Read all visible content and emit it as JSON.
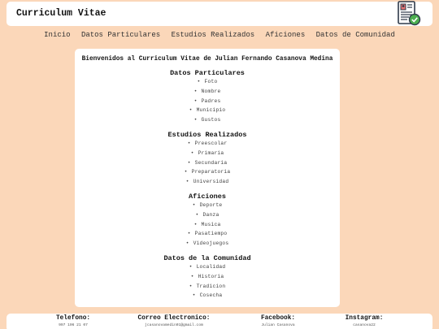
{
  "header": {
    "title": "Curriculum Vitae",
    "logo_icon": "cv-document-check-icon"
  },
  "nav": {
    "items": [
      "Inicio",
      "Datos Particulares",
      "Estudios Realizados",
      "Aficiones",
      "Datos de Comunidad"
    ]
  },
  "main": {
    "welcome": "Bienvenidos al Curriculum Vitae de Julian Fernando Casanova Medina",
    "sections": [
      {
        "title": "Datos Particulares",
        "items": [
          "Foto",
          "Nombre",
          "Padres",
          "Municipio",
          "Gustos"
        ]
      },
      {
        "title": "Estudios Realizados",
        "items": [
          "Preescolar",
          "Primaria",
          "Secundaria",
          "Preparatoria",
          "Universidad"
        ]
      },
      {
        "title": "Aficiones",
        "items": [
          "Deporte",
          "Danza",
          "Musica",
          "Pasatiempo",
          "Videojuegos"
        ]
      },
      {
        "title": "Datos de la Comunidad",
        "items": [
          "Localidad",
          "Historia",
          "Tradicion",
          "Cosecha"
        ]
      }
    ]
  },
  "footer": {
    "columns": [
      {
        "label": "Telefono:",
        "value": "997 106 21 07"
      },
      {
        "label": "Correo Electronico:",
        "value": "jcasanovamedin01@gmail.com"
      },
      {
        "label": "Facebook:",
        "value": "Julian Casanova"
      },
      {
        "label": "Instagram:",
        "value": "casanova22"
      }
    ]
  },
  "colors": {
    "background": "#fbd7b9",
    "panel": "#ffffff",
    "text": "#222222"
  }
}
